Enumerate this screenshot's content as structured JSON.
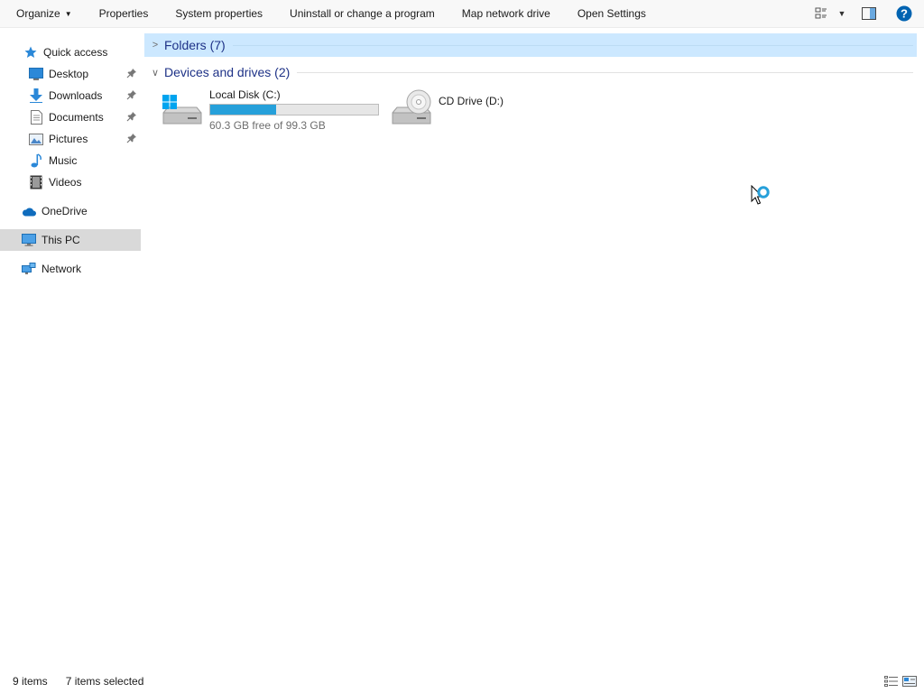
{
  "toolbar": {
    "organize": "Organize",
    "properties": "Properties",
    "system_properties": "System properties",
    "uninstall": "Uninstall or change a program",
    "map_network_drive": "Map network drive",
    "open_settings": "Open Settings",
    "right_icons": [
      "change-view-icon",
      "view-options-dropdown-icon",
      "preview-pane-icon",
      "help-icon"
    ]
  },
  "nav": {
    "quick_access": "Quick access",
    "items": [
      {
        "label": "Desktop",
        "icon": "desktop-icon",
        "pinned": true
      },
      {
        "label": "Downloads",
        "icon": "downloads-icon",
        "pinned": true
      },
      {
        "label": "Documents",
        "icon": "documents-icon",
        "pinned": true
      },
      {
        "label": "Pictures",
        "icon": "pictures-icon",
        "pinned": true
      },
      {
        "label": "Music",
        "icon": "music-icon",
        "pinned": false
      },
      {
        "label": "Videos",
        "icon": "videos-icon",
        "pinned": false
      }
    ],
    "onedrive": "OneDrive",
    "this_pc": "This PC",
    "network": "Network"
  },
  "groups": {
    "folders": "Folders (7)",
    "devices": "Devices and drives (2)"
  },
  "drives": {
    "c": {
      "name": "Local Disk (C:)",
      "free": "60.3 GB free of 99.3 GB",
      "used_fraction": 0.39
    },
    "d": {
      "name": "CD Drive (D:)"
    }
  },
  "status": {
    "items": "9 items",
    "selected": "7 items selected"
  },
  "colors": {
    "accent": "#26a0da",
    "selection": "#cce8ff",
    "header_text": "#1e3287",
    "help": "#0063b1"
  }
}
